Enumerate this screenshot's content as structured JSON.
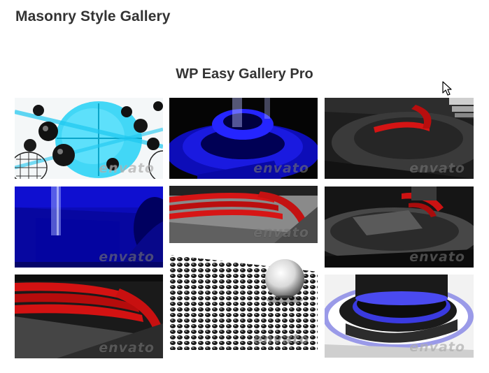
{
  "page": {
    "title": "Masonry Style Gallery"
  },
  "gallery": {
    "title": "WP Easy Gallery Pro",
    "items": [
      {
        "watermark": "envato",
        "icon": "cyan-spheres-image"
      },
      {
        "watermark": "envato",
        "icon": "blue-rings-image"
      },
      {
        "watermark": "envato",
        "icon": "dark-red-arc-image"
      },
      {
        "watermark": "envato",
        "icon": "blue-wall-image"
      },
      {
        "watermark": "envato",
        "icon": "red-stacked-rings-image"
      },
      {
        "watermark": "envato",
        "icon": "gray-disc-red-arc-image"
      },
      {
        "watermark": "envato",
        "icon": "red-arcs-closeup-image"
      },
      {
        "watermark": "envato",
        "icon": "black-dots-chrome-sphere-image"
      },
      {
        "watermark": "envato",
        "icon": "glowing-blue-rings-image"
      }
    ]
  }
}
